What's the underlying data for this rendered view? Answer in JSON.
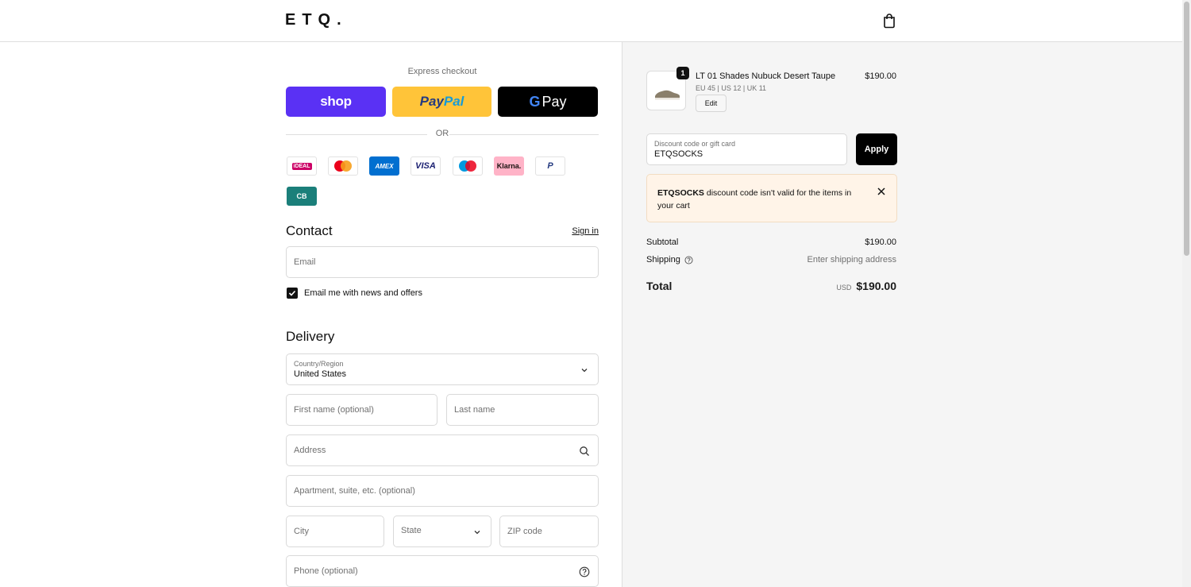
{
  "header": {
    "logo": "ETQ."
  },
  "express": {
    "title": "Express checkout",
    "shop_label": "shop",
    "paypal_label_1": "Pay",
    "paypal_label_2": "Pal",
    "gpay_g": "G",
    "gpay_label": "Pay",
    "or_label": "OR"
  },
  "payment_methods": [
    "iDEAL",
    "Mastercard",
    "AMEX",
    "VISA",
    "Maestro",
    "Klarna.",
    "PayPal",
    "CB"
  ],
  "contact": {
    "title": "Contact",
    "signin": "Sign in",
    "email_placeholder": "Email",
    "newsletter_label": "Email me with news and offers",
    "newsletter_checked": true
  },
  "delivery": {
    "title": "Delivery",
    "country_label": "Country/Region",
    "country_value": "United States",
    "first_name_placeholder": "First name (optional)",
    "last_name_placeholder": "Last name",
    "address_placeholder": "Address",
    "apartment_placeholder": "Apartment, suite, etc. (optional)",
    "city_placeholder": "City",
    "state_placeholder": "State",
    "zip_placeholder": "ZIP code",
    "phone_placeholder": "Phone (optional)"
  },
  "summary": {
    "product_name": "LT 01 Shades Nubuck Desert Taupe",
    "product_variant": "EU 45 | US 12 | UK 11",
    "quantity": "1",
    "edit_label": "Edit",
    "product_price": "$190.00",
    "discount_label": "Discount code or gift card",
    "discount_value": "ETQSOCKS",
    "apply_label": "Apply",
    "alert_code": "ETQSOCKS",
    "alert_message": " discount code isn't valid for the items in your cart",
    "subtotal_label": "Subtotal",
    "subtotal_value": "$190.00",
    "shipping_label": "Shipping",
    "shipping_value": "Enter shipping address",
    "total_label": "Total",
    "total_currency": "USD",
    "total_value": "$190.00"
  },
  "colors": {
    "shop_pay": "#5a31f4",
    "paypal": "#ffc439",
    "gpay": "#000000",
    "alert_bg": "#fff4e8"
  }
}
